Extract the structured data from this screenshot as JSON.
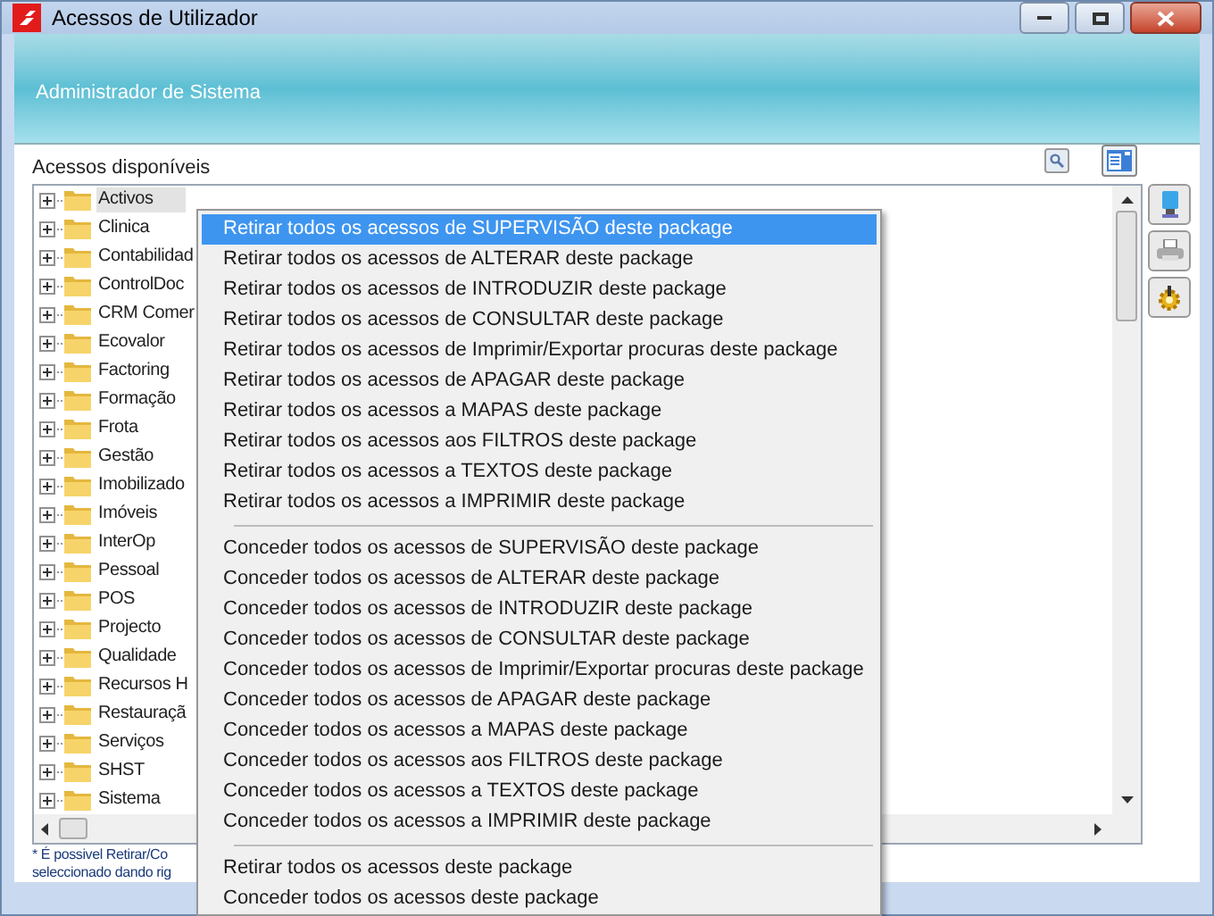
{
  "window": {
    "title": "Acessos de Utilizador"
  },
  "header": {
    "subtitle": "Administrador de Sistema"
  },
  "panel": {
    "label": "Acessos disponíveis",
    "tree": [
      {
        "label": "Activos",
        "selected": true,
        "expanded": false
      },
      {
        "label": "Clinica",
        "selected": false,
        "expanded": false
      },
      {
        "label": "Contabilidad",
        "selected": false,
        "expanded": false
      },
      {
        "label": "ControlDoc",
        "selected": false,
        "expanded": false
      },
      {
        "label": "CRM Comer",
        "selected": false,
        "expanded": false
      },
      {
        "label": "Ecovalor",
        "selected": false,
        "expanded": false
      },
      {
        "label": "Factoring",
        "selected": false,
        "expanded": false
      },
      {
        "label": "Formação",
        "selected": false,
        "expanded": false
      },
      {
        "label": "Frota",
        "selected": false,
        "expanded": false
      },
      {
        "label": "Gestão",
        "selected": false,
        "expanded": false
      },
      {
        "label": "Imobilizado",
        "selected": false,
        "expanded": false
      },
      {
        "label": "Imóveis",
        "selected": false,
        "expanded": false
      },
      {
        "label": "InterOp",
        "selected": false,
        "expanded": false
      },
      {
        "label": "Pessoal",
        "selected": false,
        "expanded": false
      },
      {
        "label": "POS",
        "selected": false,
        "expanded": false
      },
      {
        "label": "Projecto",
        "selected": false,
        "expanded": false
      },
      {
        "label": "Qualidade",
        "selected": false,
        "expanded": false
      },
      {
        "label": "Recursos H",
        "selected": false,
        "expanded": false
      },
      {
        "label": "Restauraçã",
        "selected": false,
        "expanded": false
      },
      {
        "label": "Serviços",
        "selected": false,
        "expanded": false
      },
      {
        "label": "SHST",
        "selected": false,
        "expanded": false
      },
      {
        "label": "Sistema",
        "selected": false,
        "expanded": false
      }
    ],
    "footnote": [
      "* É possivel Retirar/Co",
      "seleccionado dando rig"
    ]
  },
  "context_menu": {
    "groups": [
      [
        {
          "label": "Retirar todos os acessos de SUPERVISÃO deste package",
          "selected": true
        },
        {
          "label": "Retirar todos os acessos de ALTERAR deste package",
          "selected": false
        },
        {
          "label": "Retirar todos os acessos de INTRODUZIR deste package",
          "selected": false
        },
        {
          "label": "Retirar todos os acessos de CONSULTAR deste package",
          "selected": false
        },
        {
          "label": "Retirar todos os acessos de Imprimir/Exportar procuras deste package",
          "selected": false
        },
        {
          "label": "Retirar todos os acessos de APAGAR deste package",
          "selected": false
        },
        {
          "label": "Retirar todos os acessos a MAPAS deste package",
          "selected": false
        },
        {
          "label": "Retirar todos os acessos aos FILTROS deste package",
          "selected": false
        },
        {
          "label": "Retirar todos os acessos a TEXTOS deste package",
          "selected": false
        },
        {
          "label": "Retirar todos os acessos a IMPRIMIR deste package",
          "selected": false
        }
      ],
      [
        {
          "label": "Conceder todos os acessos de SUPERVISÃO deste package",
          "selected": false
        },
        {
          "label": "Conceder todos os acessos de ALTERAR deste package",
          "selected": false
        },
        {
          "label": "Conceder todos os acessos de INTRODUZIR deste package",
          "selected": false
        },
        {
          "label": "Conceder todos os acessos de CONSULTAR deste package",
          "selected": false
        },
        {
          "label": "Conceder todos os acessos de Imprimir/Exportar procuras deste package",
          "selected": false
        },
        {
          "label": "Conceder todos os acessos de APAGAR deste package",
          "selected": false
        },
        {
          "label": "Conceder todos os acessos a MAPAS deste package",
          "selected": false
        },
        {
          "label": "Conceder todos os acessos aos FILTROS deste package",
          "selected": false
        },
        {
          "label": "Conceder todos os acessos a TEXTOS deste package",
          "selected": false
        },
        {
          "label": "Conceder todos os acessos a IMPRIMIR deste package",
          "selected": false
        }
      ],
      [
        {
          "label": "Retirar todos os acessos deste package",
          "selected": false
        },
        {
          "label": "Conceder todos os acessos deste package",
          "selected": false
        }
      ]
    ]
  }
}
